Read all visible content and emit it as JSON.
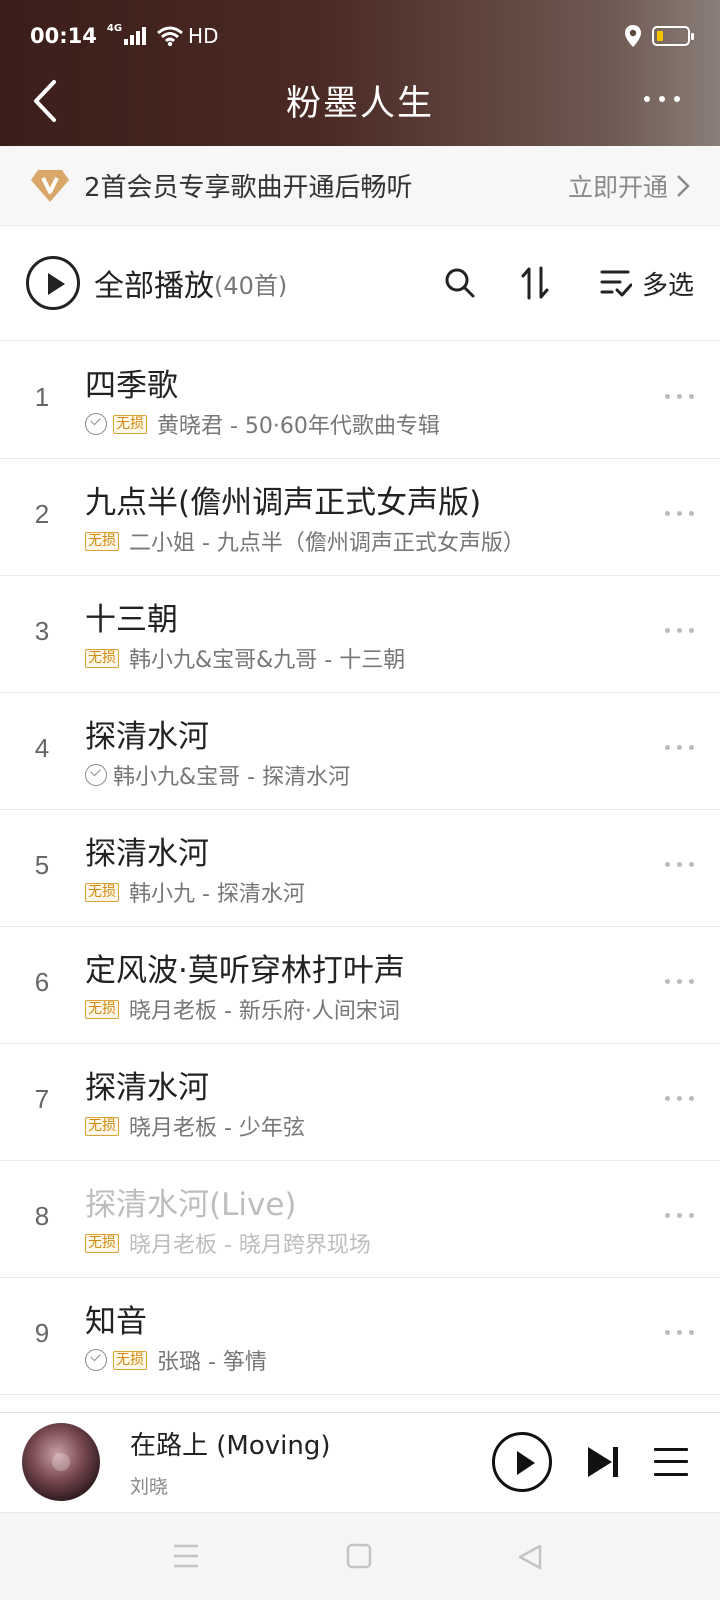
{
  "status_bar": {
    "time": "00:14",
    "network": "4G",
    "hd": "HD"
  },
  "header": {
    "title": "粉墨人生"
  },
  "vip_banner": {
    "message": "2首会员专享歌曲开通后畅听",
    "action": "立即开通"
  },
  "toolbar": {
    "play_all": "全部播放",
    "count": "(40首)",
    "multi_select": "多选"
  },
  "songs": [
    {
      "index": "1",
      "title": "四季歌",
      "subtitle": "黄晓君 - 50·60年代歌曲专辑",
      "downloaded": true,
      "lossless": true,
      "disabled": false
    },
    {
      "index": "2",
      "title": "九点半(儋州调声正式女声版)",
      "subtitle": "二小姐 - 九点半（儋州调声正式女声版）",
      "downloaded": false,
      "lossless": true,
      "disabled": false
    },
    {
      "index": "3",
      "title": "十三朝",
      "subtitle": "韩小九&宝哥&九哥 - 十三朝",
      "downloaded": false,
      "lossless": true,
      "disabled": false
    },
    {
      "index": "4",
      "title": "探清水河",
      "subtitle": "韩小九&宝哥 - 探清水河",
      "downloaded": true,
      "lossless": false,
      "disabled": false
    },
    {
      "index": "5",
      "title": "探清水河",
      "subtitle": "韩小九 - 探清水河",
      "downloaded": false,
      "lossless": true,
      "disabled": false
    },
    {
      "index": "6",
      "title": "定风波·莫听穿林打叶声",
      "subtitle": "晓月老板 - 新乐府·人间宋词",
      "downloaded": false,
      "lossless": true,
      "disabled": false
    },
    {
      "index": "7",
      "title": "探清水河",
      "subtitle": "晓月老板 - 少年弦",
      "downloaded": false,
      "lossless": true,
      "disabled": false
    },
    {
      "index": "8",
      "title": "探清水河(Live)",
      "subtitle": "晓月老板 - 晓月跨界现场",
      "downloaded": false,
      "lossless": true,
      "disabled": true
    },
    {
      "index": "9",
      "title": "知音",
      "subtitle": "张璐 - 筝情",
      "downloaded": true,
      "lossless": true,
      "disabled": false
    }
  ],
  "lossless_badge": "无损",
  "now_playing": {
    "song": "在路上 (Moving)",
    "artist": "刘晓"
  },
  "colors": {
    "header_start": "#3b1e1a",
    "header_end": "#8a7e78",
    "vip_gold": "#d9a23b"
  }
}
